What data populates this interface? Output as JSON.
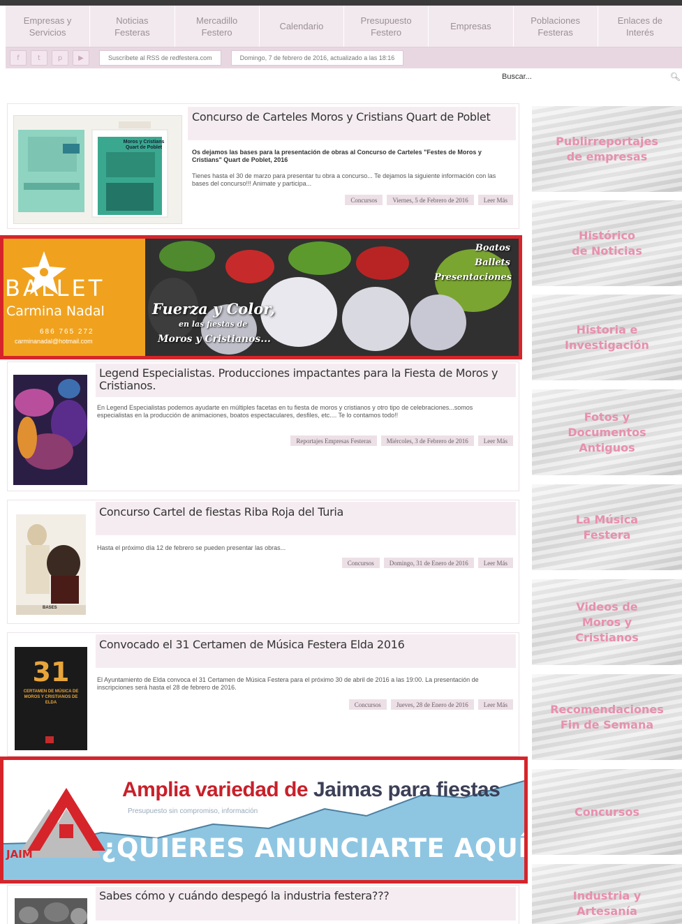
{
  "nav": {
    "items": [
      {
        "label": "Empresas y\nServicios"
      },
      {
        "label": "Noticias\nFesteras"
      },
      {
        "label": "Mercadillo\nFestero"
      },
      {
        "label": "Calendario"
      },
      {
        "label": "Presupuesto\nFestero"
      },
      {
        "label": "Empresas"
      },
      {
        "label": "Poblaciones\nFesteras"
      },
      {
        "label": "Enlaces de\nInterés"
      }
    ]
  },
  "subbar": {
    "social_icons": [
      "facebook-icon",
      "twitter-icon",
      "pinterest-icon",
      "youtube-icon"
    ],
    "social_glyphs": [
      "f",
      "t",
      "p",
      "▶"
    ],
    "rss_text": "Suscríbete al RSS de redfestera.com",
    "date_text": "Domingo, 7 de febrero de 2016, actualizado a las 18:16"
  },
  "search": {
    "placeholder": "Buscar..."
  },
  "articles": [
    {
      "title": "Concurso de Carteles Moros y Cristians Quart de Poblet",
      "lead": "Os dejamos las bases para la presentación de obras al Concurso de Carteles \"Festes de Moros y Cristians\" Quart de Poblet, 2016",
      "body": "Tienes hasta el 30 de marzo para presentar tu obra a concurso... Te dejamos la siguiente información con las bases del concurso!!! Animate y participa...",
      "category": "Concursos",
      "date": "Viernes, 5 de Febrero de 2016",
      "more": "Leer Más",
      "thumb_text": "Moros y Cristians Quart de Poblet"
    },
    {
      "title": "Legend Especialistas. Producciones impactantes para la Fiesta de Moros y Cristianos.",
      "lead": "",
      "body": "En Legend Especialistas podemos ayudarte en múltiples facetas en tu fiesta de moros y cristianos y otro tipo de celebraciones...somos especialistas en la producción de animaciones, boatos espectaculares, desfiles, etc.... Te lo contamos todo!!",
      "category": "Reportajes Empresas Festeras",
      "date": "Miércoles, 3 de Febrero de 2016",
      "more": "Leer Más"
    },
    {
      "title": "Concurso Cartel de fiestas Riba Roja del Turia",
      "lead": "",
      "body": "Hasta el próximo día 12 de febrero se pueden presentar las obras...",
      "category": "Concursos",
      "date": "Domingo, 31 de Enero de 2016",
      "more": "Leer Más",
      "thumb_text": "BASES"
    },
    {
      "title": "Convocado el 31 Certamen de Música Festera Elda 2016",
      "lead": "",
      "body": "El Ayuntamiento de Elda convoca el 31 Certamen de Música Festera para el próximo 30 de abril de 2016 a las 19:00. La presentación de inscripciones será hasta el 28 de febrero de 2016.",
      "category": "Concursos",
      "date": "Jueves, 28 de Enero de 2016",
      "more": "Leer Más",
      "thumb_number": "31",
      "thumb_text": "CERTAMEN DE MÚSICA DE MOROS Y CRISTIANOS DE ELDA"
    },
    {
      "title": "Sabes cómo y cuándo despegó la industria festera???"
    }
  ],
  "ad_ballet": {
    "brand_top": "BALLET",
    "brand_name": "Carmina Nadal",
    "phone": "686 765 272",
    "email": "carminanadal@hotmail.com",
    "tagline_1": "Boatos",
    "tagline_2": "Ballets",
    "tagline_3": "Presentaciones",
    "slogan_main": "Fuerza y Color,",
    "slogan_sub": "en las fiestas de",
    "slogan_end": "Moros y Cristianos..."
  },
  "ad_jaimas": {
    "headline_red": "Amplia variedad de",
    "headline_dark": "Jaimas para fiestas",
    "small_text": "Presupuesto sin compromiso, información",
    "cta": "¿QUIERES ANUNCIARTE AQUÍ?",
    "logo_text": "JAIM"
  },
  "sidebar": [
    {
      "label": "Publirreportajes\nde empresas"
    },
    {
      "label": "Histórico\nde Noticias"
    },
    {
      "label": "Historia e\nInvestigación"
    },
    {
      "label": "Fotos y\nDocumentos\nAntiguos"
    },
    {
      "label": "La Música\nFestera"
    },
    {
      "label": "Videos de\nMoros y\nCristianos"
    },
    {
      "label": "Recomendaciones\nFin de Semana"
    },
    {
      "label": "Concursos"
    },
    {
      "label": "Industria y\nArtesanía"
    }
  ],
  "colors": {
    "nav_bg": "#f2e9ee",
    "subbar_bg": "#e8d7e1",
    "ad_border": "#d6242b",
    "sidebar_text": "#e88fae",
    "ballet_orange": "#f0a21e",
    "jaimas_sky": "#8ec6e2"
  }
}
